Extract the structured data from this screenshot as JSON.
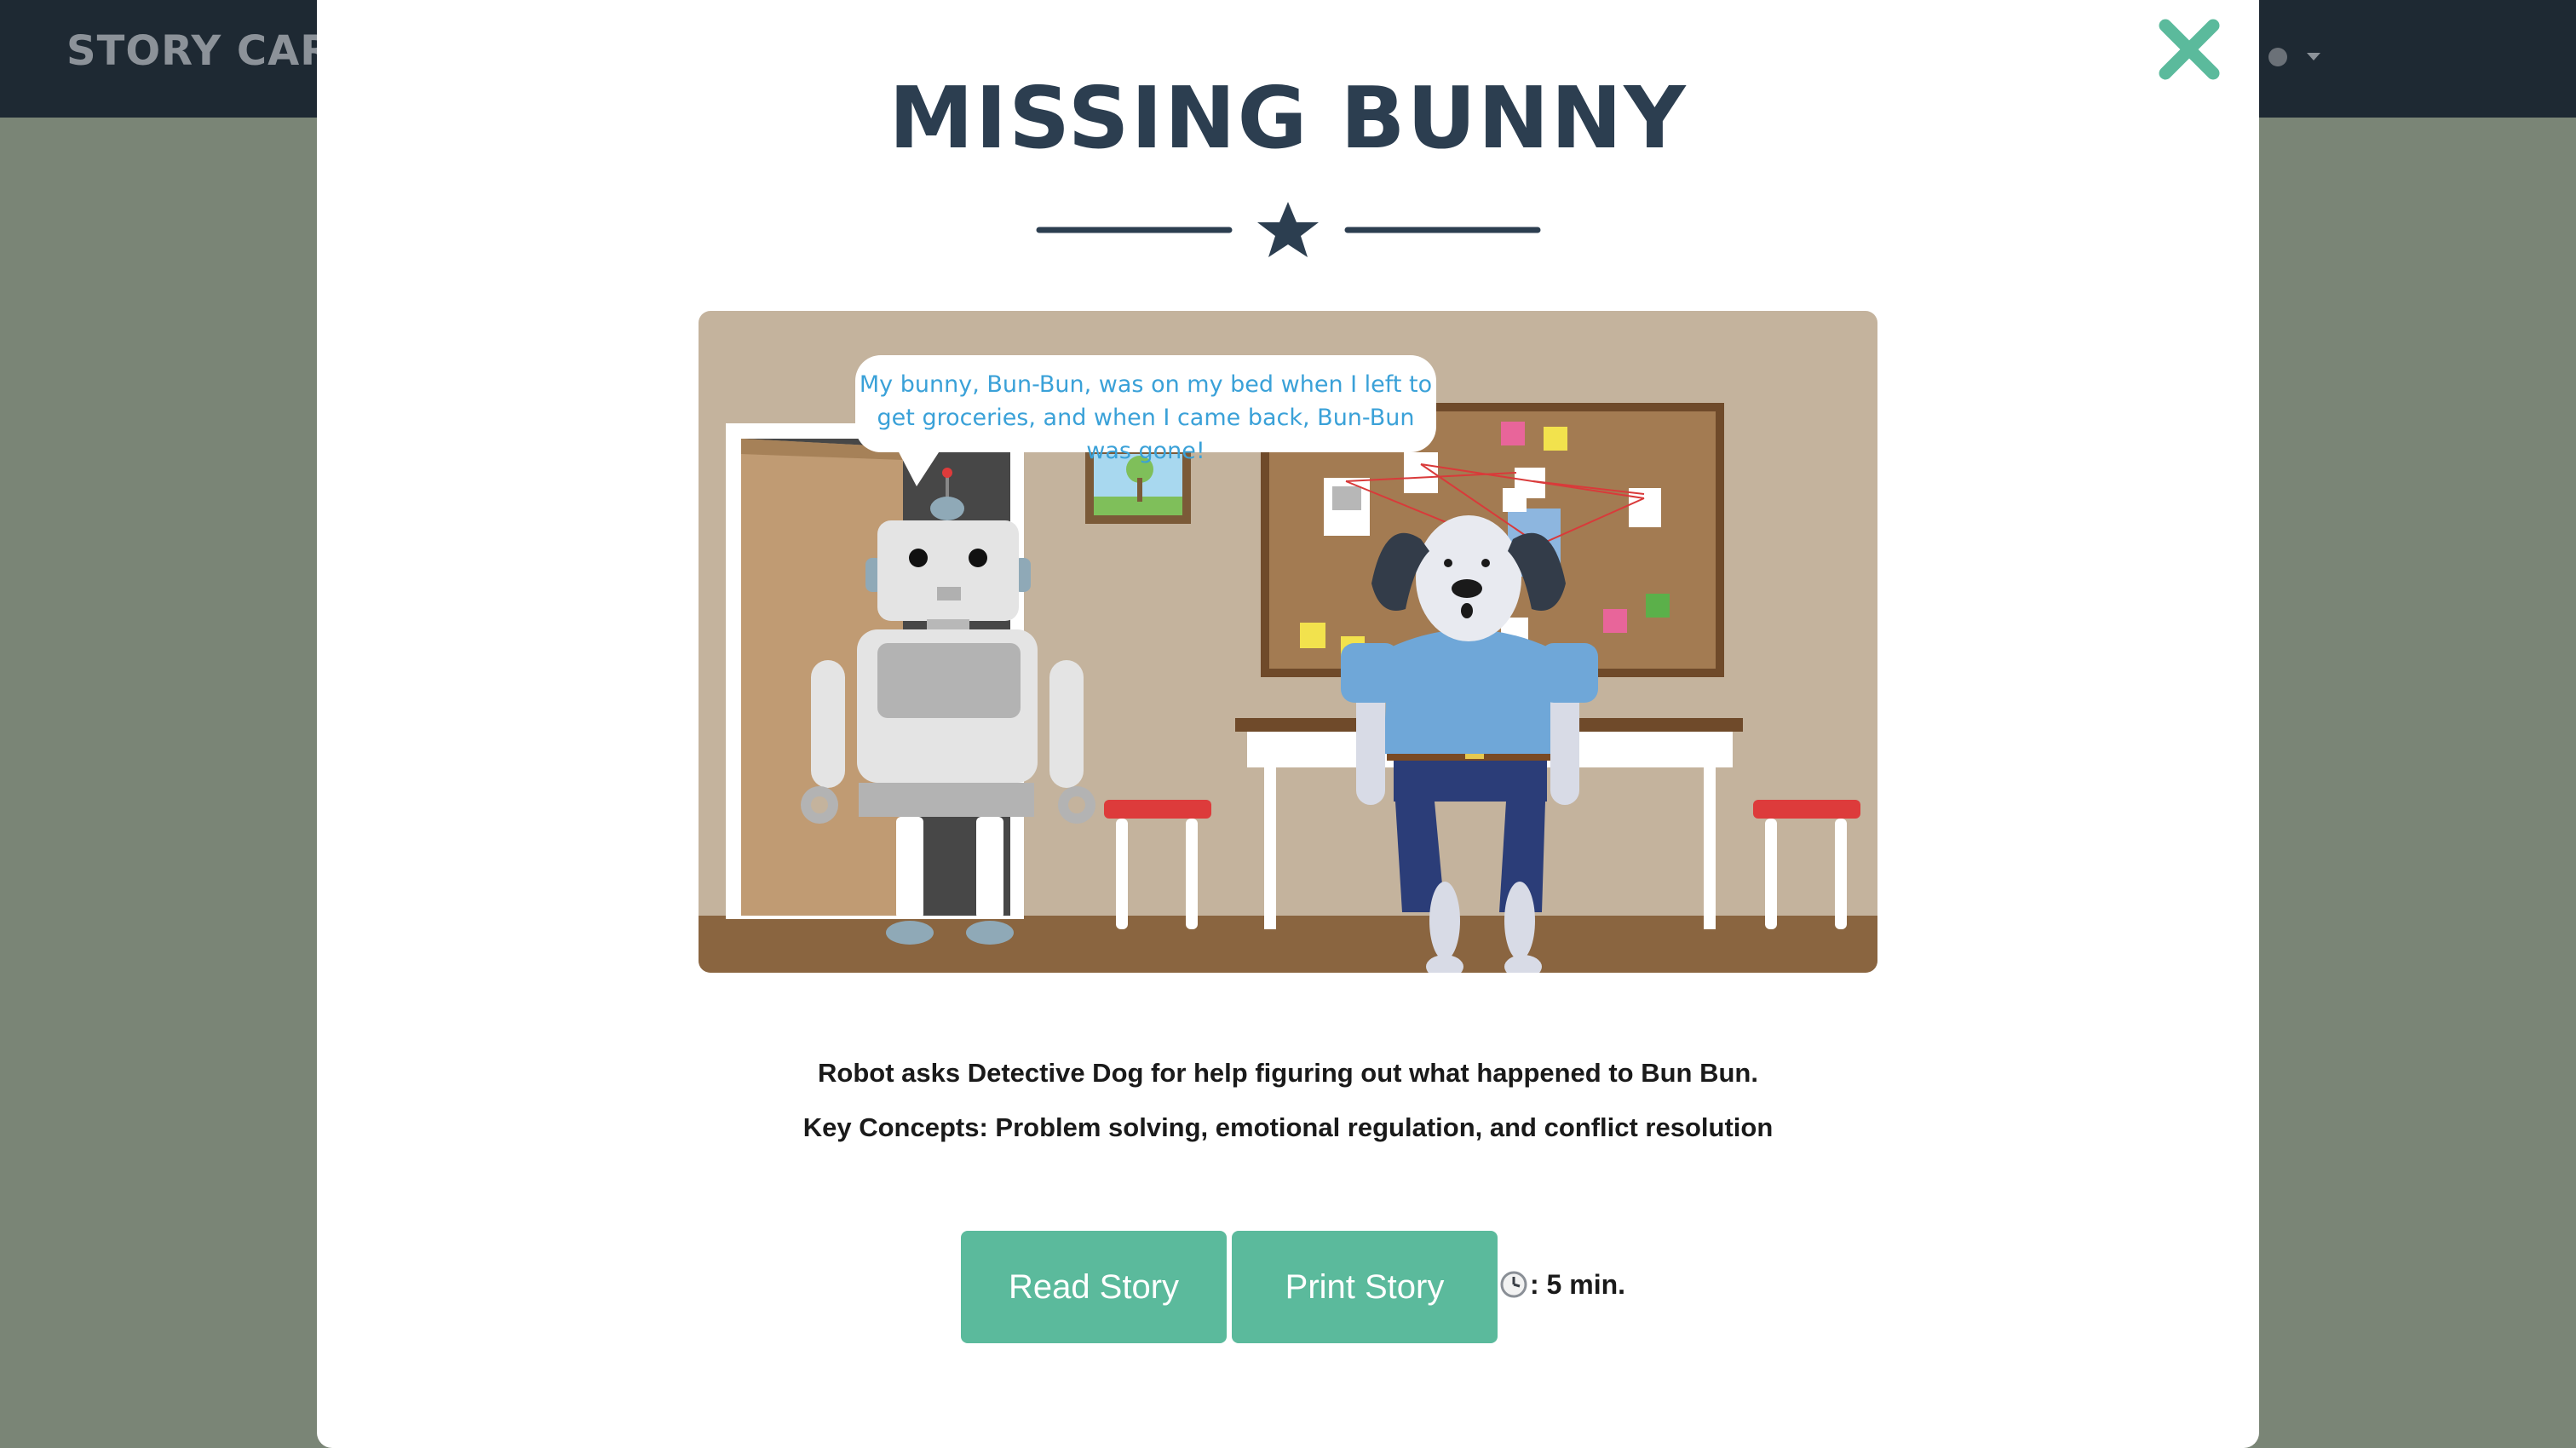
{
  "header": {
    "brand": "STORY CAR"
  },
  "story": {
    "title": "MISSING BUNNY",
    "speech_bubble": "My bunny, Bun-Bun, was on my bed when I left to get groceries, and when I came back, Bun-Bun was gone!",
    "description": "Robot asks Detective Dog for help figuring out what happened to Bun Bun.",
    "key_concepts": "Key Concepts: Problem solving, emotional regulation, and conflict resolution",
    "duration": ": 5 min."
  },
  "actions": {
    "read_label": "Read Story",
    "print_label": "Print Story"
  },
  "icons": {
    "close": "close-x-icon",
    "divider": "star-icon",
    "duration": "clock-icon"
  },
  "colors": {
    "accent": "#5bba9c",
    "title": "#2c3e50",
    "navbar": "#1e2933",
    "overlay": "#7a8576",
    "bubble_text": "#3aa1d8"
  }
}
